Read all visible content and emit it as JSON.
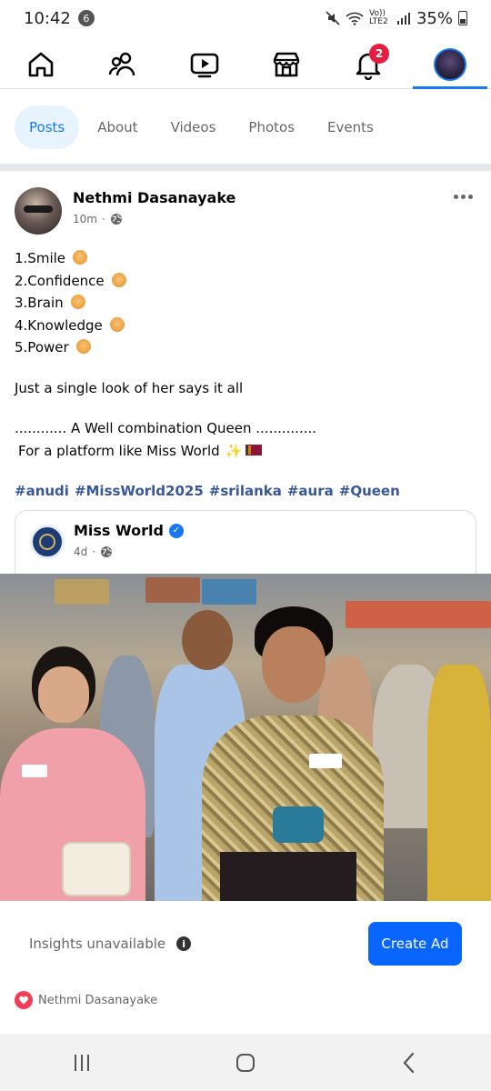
{
  "status_bar": {
    "time": "10:42",
    "notification_count": "6",
    "network_label": "Vo)) LTE2",
    "battery_percent": "35%"
  },
  "top_nav": {
    "items": [
      {
        "name": "home",
        "icon": "home-icon"
      },
      {
        "name": "friends",
        "icon": "friends-icon"
      },
      {
        "name": "video",
        "icon": "video-icon"
      },
      {
        "name": "marketplace",
        "icon": "marketplace-icon"
      },
      {
        "name": "notifications",
        "icon": "bell-icon",
        "badge": "2"
      },
      {
        "name": "profile",
        "icon": "profile-avatar"
      }
    ],
    "active": "profile",
    "accent_color": "#1877f2",
    "badge_color": "#e41e3f"
  },
  "profile_tabs": {
    "items": [
      "Posts",
      "About",
      "Videos",
      "Photos",
      "Events"
    ],
    "active": "Posts"
  },
  "post": {
    "author": "Nethmi Dasanayake",
    "time": "10m",
    "dot": "·",
    "privacy_icon": "globe-icon",
    "lines": [
      "1.Smile",
      "2.Confidence",
      "3.Brain",
      "4.Knowledge",
      "5.Power"
    ],
    "line_emoji_icon": "woman-emoji-icon",
    "tagline": "Just a single look of her says it all",
    "combination_line": "............ A Well combination Queen ..............",
    "platform_line": "For a platform like Miss World",
    "platform_emoji": "✨",
    "hashtags": [
      "#anudi",
      "#MissWorld2025",
      "#srilanka",
      "#aura",
      "#Queen"
    ],
    "hashtag_color": "#385898"
  },
  "shared": {
    "name": "Miss World",
    "time": "4d",
    "dot": "·",
    "verified_icon": "verified-icon"
  },
  "insights": {
    "text": "Insights unavailable",
    "info_icon": "i",
    "create_ad_label": "Create Ad",
    "button_color": "#0866ff"
  },
  "reactions": {
    "names": "Nethmi Dasanayake",
    "icon": "heart-reaction-icon"
  }
}
